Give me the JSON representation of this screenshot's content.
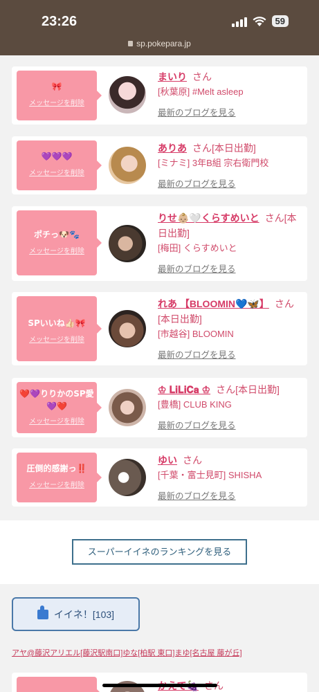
{
  "status": {
    "time": "23:26",
    "battery": "59"
  },
  "browser": {
    "url": "sp.pokepara.jp"
  },
  "cards": [
    {
      "message": "🎀",
      "delete_label": "メッセージを削除",
      "name": "まいり",
      "san": "さん",
      "shop": "[秋葉原] #Melt asleep",
      "blog": "最新のブログを見る"
    },
    {
      "message": "💜💜💜",
      "delete_label": "メッセージを削除",
      "name": "ありあ",
      "san": "さん[本日出勤]",
      "shop": "[ミナミ] 3年B組 宗右衛門校",
      "blog": "最新のブログを見る"
    },
    {
      "message": "ポチっ🐶🐾",
      "delete_label": "メッセージを削除",
      "name": "りせ👶🏼🤍くらすめいと",
      "san": "さん[本日出勤]",
      "shop": "[梅田] くらすめいと",
      "blog": "最新のブログを見る"
    },
    {
      "message": "SPいいね👍🏻🎀",
      "delete_label": "メッセージを削除",
      "name": "れあ 【BLOOMIN💙🦋】",
      "san": "さん[本日出勤]",
      "shop": "[市越谷] BLOOMIN",
      "blog": "最新のブログを見る"
    },
    {
      "message": "❤️💜りりかのSP愛💜❤️",
      "delete_label": "メッセージを削除",
      "name": "♔ 𝐋𝐢𝐋𝐢𝐂𝐚 ♔",
      "san": "さん[本日出勤]",
      "shop": "[豊橋] CLUB KING",
      "blog": "最新のブログを見る"
    },
    {
      "message": "圧倒的感謝っ‼️",
      "delete_label": "メッセージを削除",
      "name": "ゆい",
      "san": "さん",
      "shop": "[千葉・富士見町] SHISHA",
      "blog": "最新のブログを見る"
    },
    {
      "name": "かえで🍇",
      "san": "さん"
    }
  ],
  "ranking_button": "スーパーイイネのランキングを見る",
  "iine_button": "イイネ！[103]",
  "liked_by": "アヤ@藤沢アリエル[藤沢駅南口]ゆな[柏駅 東口]まゆ[名古屋 藤が丘]",
  "colors": {
    "bubble": "#f898a6",
    "accent": "#d63a66",
    "header": "#5b4b3f"
  }
}
